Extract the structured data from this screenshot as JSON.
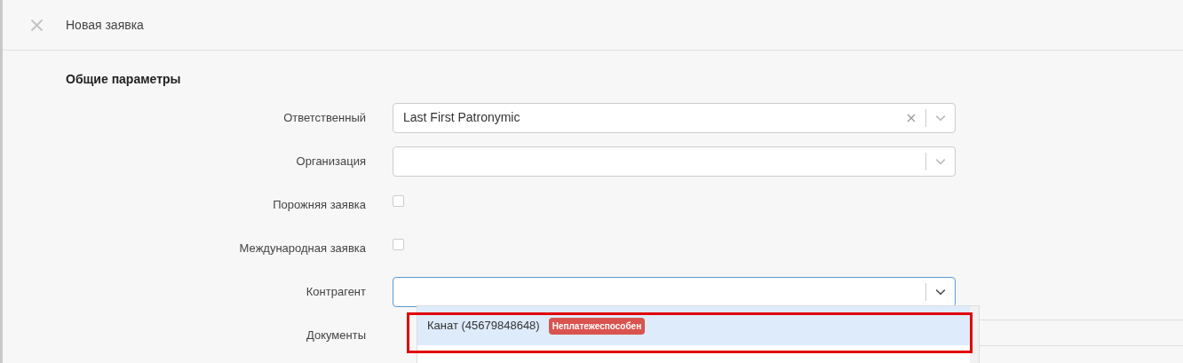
{
  "header": {
    "title": "Новая заявка"
  },
  "section": {
    "title": "Общие параметры"
  },
  "fields": [
    {
      "kind": "select",
      "label": "Ответственный",
      "value": "Last First Patronymic",
      "clearable": true,
      "focused": false
    },
    {
      "kind": "select",
      "label": "Организация",
      "clearable": false,
      "focused": false
    },
    {
      "kind": "checkbox",
      "label": "Порожняя заявка",
      "checked": false
    },
    {
      "kind": "checkbox",
      "label": "Международная заявка",
      "checked": false
    },
    {
      "kind": "select",
      "label": "Контрагент",
      "clearable": false,
      "focused": true,
      "dropdown": {
        "options": [
          {
            "text": "Канат (45679848648)",
            "badge": "Неплатежеспособен",
            "selected": true
          }
        ]
      }
    },
    {
      "kind": "documents",
      "label": "Документы"
    }
  ]
}
